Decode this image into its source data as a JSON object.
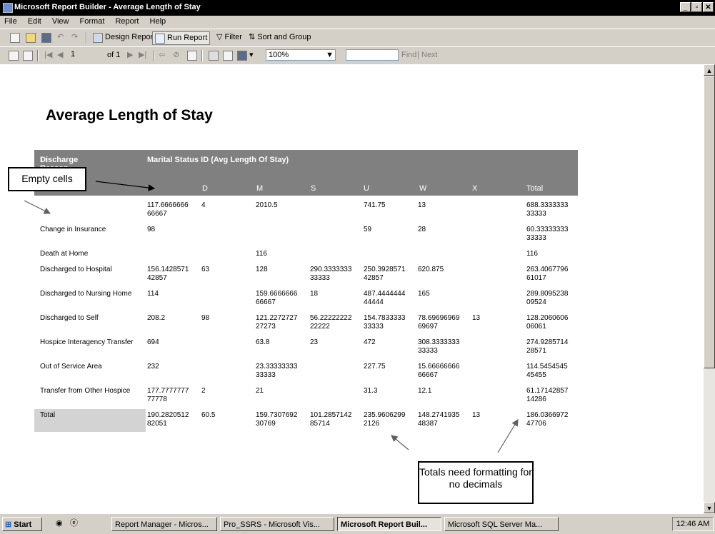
{
  "window": {
    "title": "Microsoft Report Builder - Average Length of Stay"
  },
  "menu": [
    "File",
    "Edit",
    "View",
    "Format",
    "Report",
    "Help"
  ],
  "toolbar1": {
    "design_report": "Design Report",
    "run_report": "Run Report",
    "filter": "Filter",
    "sort_group": "Sort and Group"
  },
  "toolbar2": {
    "page_input": "1",
    "page_of": "of 1",
    "zoom": "100%",
    "find_label": "Find",
    "separator": "|",
    "next_label": "Next"
  },
  "report": {
    "title": "Average Length of Stay",
    "header": {
      "row_label": "Discharge Reason",
      "sort_glyph": "↓↑",
      "group_label": "Marital Status ID (Avg Length Of Stay)",
      "columns": [
        "D",
        "M",
        "S",
        "U",
        "W",
        "X",
        "Total"
      ]
    },
    "rows": [
      {
        "label": "",
        "values": [
          "117.6666666\n66667",
          "4",
          "2010.5",
          "",
          "741.75",
          "13",
          "",
          "688.3333333\n33333"
        ]
      },
      {
        "label": "Change in Insurance",
        "values": [
          "98",
          "",
          "",
          "",
          "59",
          "28",
          "",
          "60.33333333\n33333"
        ]
      },
      {
        "label": "Death at Home",
        "values": [
          "",
          "",
          "116",
          "",
          "",
          "",
          "",
          "116"
        ]
      },
      {
        "label": "Discharged to Hospital",
        "values": [
          "156.1428571\n42857",
          "63",
          "128",
          "290.3333333\n33333",
          "250.3928571\n42857",
          "620.875",
          "",
          "263.4067796\n61017"
        ]
      },
      {
        "label": "Discharged to Nursing Home",
        "values": [
          "114",
          "",
          "159.6666666\n66667",
          "18",
          "487.4444444\n44444",
          "165",
          "",
          "289.8095238\n09524"
        ]
      },
      {
        "label": "Discharged to Self",
        "values": [
          "208.2",
          "98",
          "121.2272727\n27273",
          "56.22222222\n22222",
          "154.7833333\n33333",
          "78.69696969\n69697",
          "13",
          "128.2060606\n06061"
        ]
      },
      {
        "label": "Hospice Interagency Transfer",
        "values": [
          "694",
          "",
          "63.8",
          "23",
          "472",
          "308.3333333\n33333",
          "",
          "274.9285714\n28571"
        ]
      },
      {
        "label": "Out of Service Area",
        "values": [
          "232",
          "",
          "23.33333333\n33333",
          "",
          "227.75",
          "15.66666666\n66667",
          "",
          "114.5454545\n45455"
        ]
      },
      {
        "label": "Transfer from Other Hospice",
        "values": [
          "177.7777777\n77778",
          "2",
          "21",
          "",
          "31.3",
          "12.1",
          "",
          "61.17142857\n14286"
        ]
      },
      {
        "label": "Total",
        "values": [
          "190.2820512\n82051",
          "60.5",
          "159.7307692\n30769",
          "101.2857142\n85714",
          "235.9606299\n2126",
          "148.2741935\n48387",
          "13",
          "186.0366972\n47706"
        ]
      }
    ]
  },
  "callouts": {
    "empty_cells": "Empty cells",
    "totals_note": "Totals need formatting for no decimals"
  },
  "taskbar": {
    "start": "Start",
    "tasks": [
      "Report Manager - Micros...",
      "Pro_SSRS - Microsoft Vis...",
      "Microsoft Report Buil...",
      "Microsoft SQL Server Ma..."
    ],
    "clock": "12:46 AM"
  },
  "colors": {
    "header_bg": "#808080",
    "total_bg": "#d3d3d3",
    "titlebar_bg": "#000000"
  }
}
